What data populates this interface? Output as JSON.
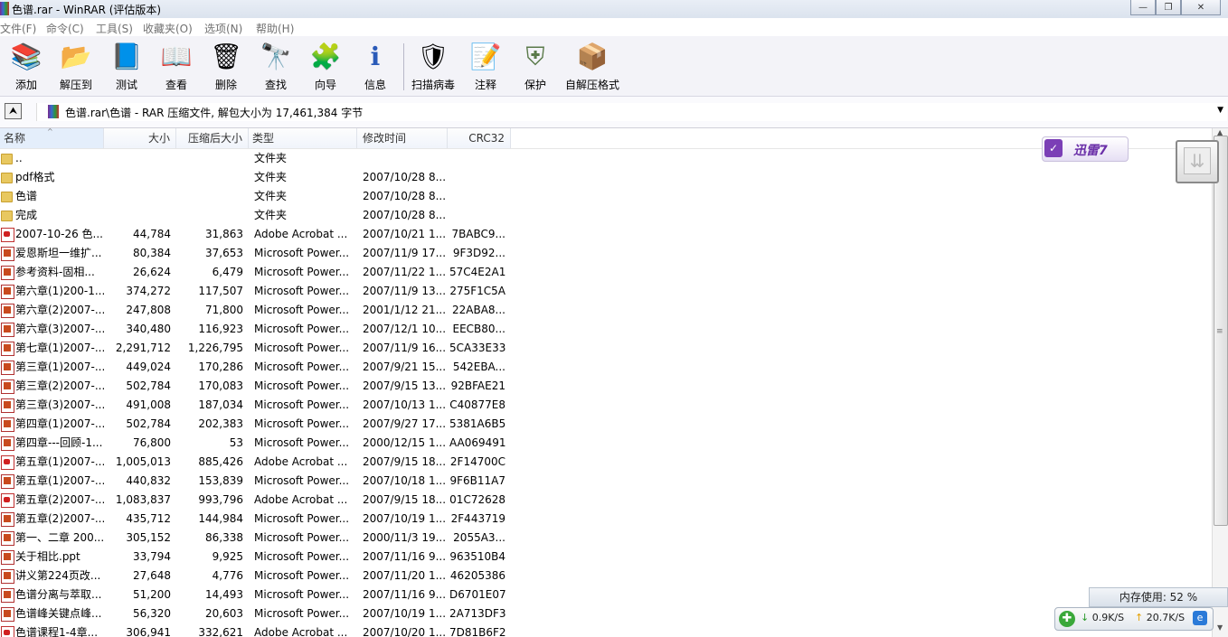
{
  "window": {
    "title": "色谱.rar - WinRAR (评估版本)",
    "buttons": {
      "minimize": "—",
      "maximize": "❐",
      "close": "✕"
    }
  },
  "menu": [
    "文件(F)",
    "命令(C)",
    "工具(S)",
    "收藏夹(O)",
    "选项(N)",
    "帮助(H)"
  ],
  "toolbar": [
    {
      "label": "添加",
      "icon": "add-archive-icon",
      "glyph": "📚",
      "color": "#8a3fb0"
    },
    {
      "label": "解压到",
      "icon": "extract-to-icon",
      "glyph": "📂",
      "color": "#c8a030"
    },
    {
      "label": "测试",
      "icon": "test-icon",
      "glyph": "📘",
      "color": "#2a5ab8"
    },
    {
      "label": "查看",
      "icon": "view-icon",
      "glyph": "📖",
      "color": "#666666"
    },
    {
      "label": "删除",
      "icon": "delete-icon",
      "glyph": "🗑",
      "color": "#c84030"
    },
    {
      "label": "查找",
      "icon": "find-icon",
      "glyph": "🔭",
      "color": "#444444"
    },
    {
      "label": "向导",
      "icon": "wizard-icon",
      "glyph": "🧩",
      "color": "#a03070"
    },
    {
      "label": "信息",
      "icon": "info-icon",
      "glyph": "ℹ",
      "color": "#2a5ab8"
    },
    {
      "label": "扫描病毒",
      "icon": "virus-scan-icon",
      "glyph": "🛡",
      "color": "#d0a020"
    },
    {
      "label": "注释",
      "icon": "comment-icon",
      "glyph": "📝",
      "color": "#3a6ad0"
    },
    {
      "label": "保护",
      "icon": "protect-icon",
      "glyph": "⛨",
      "color": "#5a7a4a"
    },
    {
      "label": "自解压格式",
      "icon": "sfx-icon",
      "glyph": "📦",
      "color": "#2a9a3a"
    }
  ],
  "address": {
    "path": "色谱.rar\\色谱 - RAR 压缩文件, 解包大小为 17,461,384 字节",
    "up_glyph": "⮝",
    "drop_glyph": "▼"
  },
  "columns": {
    "name": "名称",
    "size": "大小",
    "packed": "压缩后大小",
    "type": "类型",
    "modified": "修改时间",
    "crc": "CRC32",
    "sort_glyph": "^"
  },
  "files": [
    {
      "icon": "folder",
      "name": "..",
      "size": "",
      "packed": "",
      "type": "文件夹",
      "modified": "",
      "crc": ""
    },
    {
      "icon": "folder",
      "name": "pdf格式",
      "size": "",
      "packed": "",
      "type": "文件夹",
      "modified": "2007/10/28 8...",
      "crc": ""
    },
    {
      "icon": "folder",
      "name": "色谱",
      "size": "",
      "packed": "",
      "type": "文件夹",
      "modified": "2007/10/28 8...",
      "crc": ""
    },
    {
      "icon": "folder",
      "name": "完成",
      "size": "",
      "packed": "",
      "type": "文件夹",
      "modified": "2007/10/28 8...",
      "crc": ""
    },
    {
      "icon": "pdf",
      "name": "2007-10-26 色...",
      "size": "44,784",
      "packed": "31,863",
      "type": "Adobe Acrobat ...",
      "modified": "2007/10/21 1...",
      "crc": "7BABC9..."
    },
    {
      "icon": "ppt",
      "name": "爱恩斯坦一维扩...",
      "size": "80,384",
      "packed": "37,653",
      "type": "Microsoft Power...",
      "modified": "2007/11/9 17...",
      "crc": "9F3D92..."
    },
    {
      "icon": "ppt",
      "name": "参考资料-固相...",
      "size": "26,624",
      "packed": "6,479",
      "type": "Microsoft Power...",
      "modified": "2007/11/22 1...",
      "crc": "57C4E2A1"
    },
    {
      "icon": "ppt",
      "name": "第六章(1)200-1...",
      "size": "374,272",
      "packed": "117,507",
      "type": "Microsoft Power...",
      "modified": "2007/11/9 13...",
      "crc": "275F1C5A"
    },
    {
      "icon": "ppt",
      "name": "第六章(2)2007-...",
      "size": "247,808",
      "packed": "71,800",
      "type": "Microsoft Power...",
      "modified": "2001/1/12 21...",
      "crc": "22ABA8..."
    },
    {
      "icon": "ppt",
      "name": "第六章(3)2007-...",
      "size": "340,480",
      "packed": "116,923",
      "type": "Microsoft Power...",
      "modified": "2007/12/1 10...",
      "crc": "EECB80..."
    },
    {
      "icon": "ppt",
      "name": "第七章(1)2007-...",
      "size": "2,291,712",
      "packed": "1,226,795",
      "type": "Microsoft Power...",
      "modified": "2007/11/9 16...",
      "crc": "5CA33E33"
    },
    {
      "icon": "ppt",
      "name": "第三章(1)2007-...",
      "size": "449,024",
      "packed": "170,286",
      "type": "Microsoft Power...",
      "modified": "2007/9/21 15...",
      "crc": "542EBA..."
    },
    {
      "icon": "ppt",
      "name": "第三章(2)2007-...",
      "size": "502,784",
      "packed": "170,083",
      "type": "Microsoft Power...",
      "modified": "2007/9/15 13...",
      "crc": "92BFAE21"
    },
    {
      "icon": "ppt",
      "name": "第三章(3)2007-...",
      "size": "491,008",
      "packed": "187,034",
      "type": "Microsoft Power...",
      "modified": "2007/10/13 1...",
      "crc": "C40877E8"
    },
    {
      "icon": "ppt",
      "name": "第四章(1)2007-...",
      "size": "502,784",
      "packed": "202,383",
      "type": "Microsoft Power...",
      "modified": "2007/9/27 17...",
      "crc": "5381A6B5"
    },
    {
      "icon": "ppt",
      "name": "第四章---回顾-1...",
      "size": "76,800",
      "packed": "53",
      "type": "Microsoft Power...",
      "modified": "2000/12/15 1...",
      "crc": "AA069491"
    },
    {
      "icon": "pdf",
      "name": "第五章(1)2007-...",
      "size": "1,005,013",
      "packed": "885,426",
      "type": "Adobe Acrobat ...",
      "modified": "2007/9/15 18...",
      "crc": "2F14700C"
    },
    {
      "icon": "ppt",
      "name": "第五章(1)2007-...",
      "size": "440,832",
      "packed": "153,839",
      "type": "Microsoft Power...",
      "modified": "2007/10/18 1...",
      "crc": "9F6B11A7"
    },
    {
      "icon": "pdf",
      "name": "第五章(2)2007-...",
      "size": "1,083,837",
      "packed": "993,796",
      "type": "Adobe Acrobat ...",
      "modified": "2007/9/15 18...",
      "crc": "01C72628"
    },
    {
      "icon": "ppt",
      "name": "第五章(2)2007-...",
      "size": "435,712",
      "packed": "144,984",
      "type": "Microsoft Power...",
      "modified": "2007/10/19 1...",
      "crc": "2F443719"
    },
    {
      "icon": "ppt",
      "name": "第一、二章 200...",
      "size": "305,152",
      "packed": "86,338",
      "type": "Microsoft Power...",
      "modified": "2000/11/3 19...",
      "crc": "2055A3..."
    },
    {
      "icon": "ppt",
      "name": "关于相比.ppt",
      "size": "33,794",
      "packed": "9,925",
      "type": "Microsoft Power...",
      "modified": "2007/11/16 9...",
      "crc": "963510B4"
    },
    {
      "icon": "ppt",
      "name": "讲义第224页改...",
      "size": "27,648",
      "packed": "4,776",
      "type": "Microsoft Power...",
      "modified": "2007/11/20 1...",
      "crc": "46205386"
    },
    {
      "icon": "ppt",
      "name": "色谱分离与萃取...",
      "size": "51,200",
      "packed": "14,493",
      "type": "Microsoft Power...",
      "modified": "2007/11/16 9...",
      "crc": "D6701E07"
    },
    {
      "icon": "ppt",
      "name": "色谱峰关键点峰...",
      "size": "56,320",
      "packed": "20,603",
      "type": "Microsoft Power...",
      "modified": "2007/10/19 1...",
      "crc": "2A713DF3"
    },
    {
      "icon": "pdf",
      "name": "色谱课程1-4章...",
      "size": "306,941",
      "packed": "332,621",
      "type": "Adobe Acrobat ...",
      "modified": "2007/10/20 1...",
      "crc": "7D81B6F2"
    }
  ],
  "scrollbar": {
    "up": "▲",
    "down": "▼",
    "grip": "≡"
  },
  "xunlei": {
    "label": "迅雷7",
    "logo": "✓"
  },
  "float_box": {
    "glyph": "⇊"
  },
  "memory": {
    "text": "内存使用: 52 %"
  },
  "speed": {
    "icon": "✚",
    "down_arrow": "↓",
    "down": "0.9K/S",
    "up_arrow": "↑",
    "up": "20.7K/S",
    "ie": "e"
  }
}
